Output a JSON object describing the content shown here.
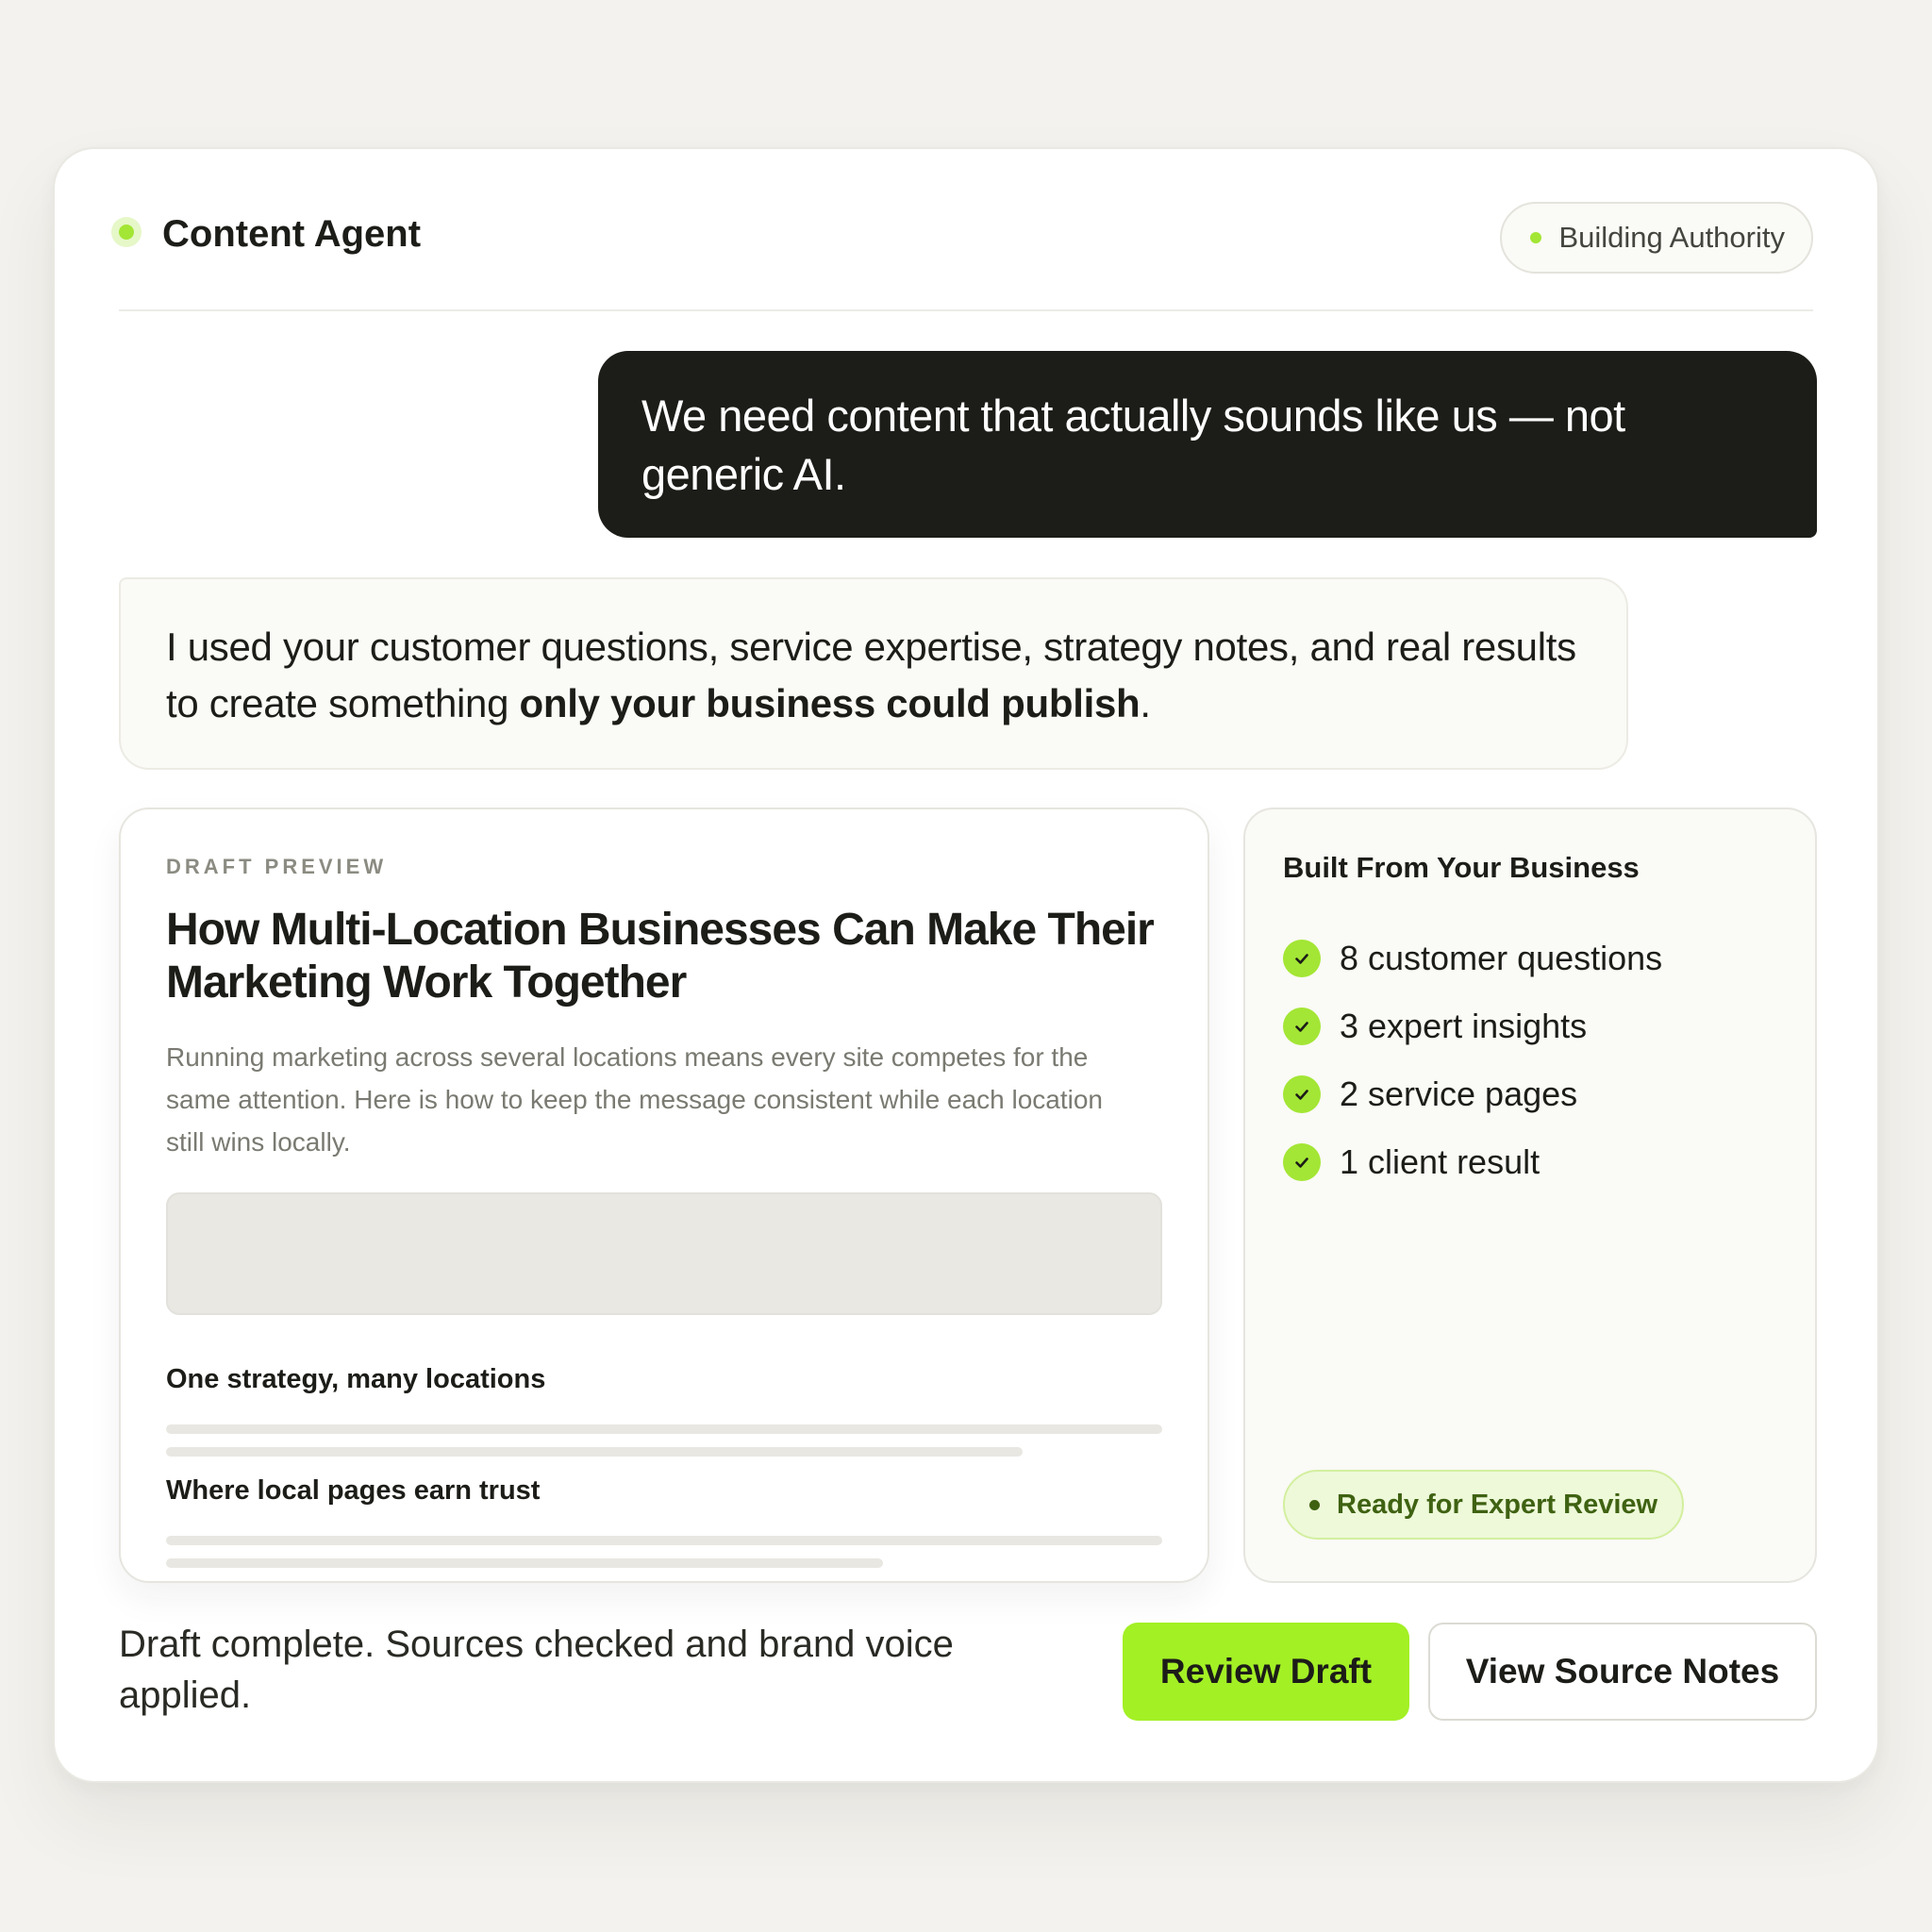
{
  "header": {
    "app_title": "Content Agent",
    "status_pill": "Building Authority"
  },
  "chat": {
    "user_message": "We need content that actually sounds like us — not generic AI.",
    "agent_message_prefix": "I used your customer questions, service expertise, strategy notes, and real results to create something ",
    "agent_message_emphasis": "only your business could publish",
    "agent_message_suffix": "."
  },
  "draft": {
    "eyebrow": "DRAFT PREVIEW",
    "title": "How Multi-Location Businesses Can Make Their Marketing Work Together",
    "excerpt": "Running marketing across several locations means every site competes for the same attention. Here is how to keep the message consistent while each location still wins locally.",
    "sections": [
      {
        "heading": "One strategy, many locations"
      },
      {
        "heading": "Where local pages earn trust"
      }
    ]
  },
  "sources": {
    "heading": "Built From Your Business",
    "items": [
      {
        "label": "8 customer questions"
      },
      {
        "label": "3 expert insights"
      },
      {
        "label": "2 service pages"
      },
      {
        "label": "1 client result"
      }
    ],
    "status_badge": "Ready for Expert Review"
  },
  "footer": {
    "status_text": "Draft complete. Sources checked and brand voice applied.",
    "primary_button": "Review Draft",
    "secondary_button": "View Source Notes"
  },
  "colors": {
    "accent": "#a3e635",
    "button_accent": "#a3f025",
    "dark_bubble": "#1c1c18",
    "badge_text": "#3f6212",
    "background": "#f3f2ee"
  },
  "icons": {
    "status": "status-dot-icon",
    "check": "check-circle-icon"
  }
}
